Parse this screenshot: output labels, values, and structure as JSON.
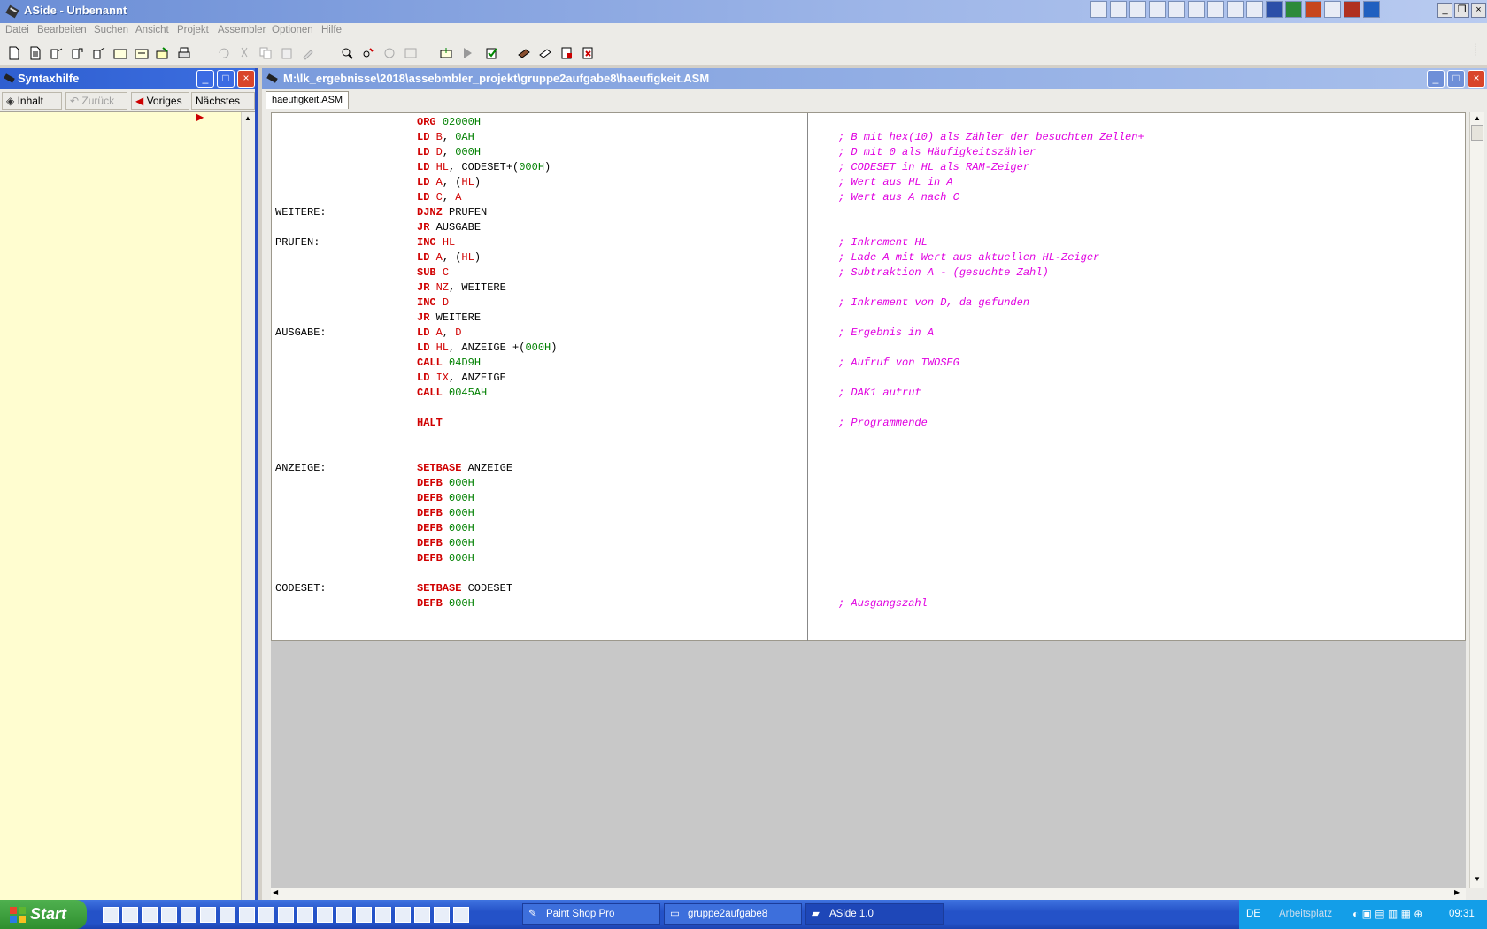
{
  "window": {
    "title": "ASide - Unbenannt"
  },
  "menu": [
    "Datei",
    "Bearbeiten",
    "Suchen",
    "Ansicht",
    "Projekt",
    "Assembler",
    "Optionen",
    "Hilfe"
  ],
  "syntax_panel": {
    "title": "Syntaxhilfe",
    "nav": {
      "contents": "Inhalt",
      "back": "Zurück",
      "previous": "Voriges",
      "next": "Nächstes"
    }
  },
  "editor": {
    "path": "M:\\lk_ergebnisse\\2018\\assebmbler_projekt\\gruppe2aufgabe8\\haeufigkeit.ASM",
    "tab": "haeufigkeit.ASM",
    "lines": [
      {
        "label": "",
        "code": [
          [
            "kw",
            "ORG "
          ],
          [
            "num",
            "02000H"
          ]
        ],
        "comment": ""
      },
      {
        "label": "",
        "code": [
          [
            "kw",
            "LD "
          ],
          [
            "reg",
            "B"
          ],
          [
            "txt",
            ", "
          ],
          [
            "num",
            "0AH"
          ]
        ],
        "comment": "; B mit hex(10) als Zähler der besuchten Zellen+"
      },
      {
        "label": "",
        "code": [
          [
            "kw",
            "LD "
          ],
          [
            "reg",
            "D"
          ],
          [
            "txt",
            ", "
          ],
          [
            "num",
            "000H"
          ]
        ],
        "comment": "; D mit 0 als Häufigkeitszähler"
      },
      {
        "label": "",
        "code": [
          [
            "kw",
            "LD "
          ],
          [
            "reg",
            "HL"
          ],
          [
            "txt",
            ", CODESET+("
          ],
          [
            "num",
            "000H"
          ],
          [
            "txt",
            ")"
          ]
        ],
        "comment": "; CODESET in HL als RAM-Zeiger"
      },
      {
        "label": "",
        "code": [
          [
            "kw",
            "LD "
          ],
          [
            "reg",
            "A"
          ],
          [
            "txt",
            ", ("
          ],
          [
            "reg",
            "HL"
          ],
          [
            "txt",
            ")"
          ]
        ],
        "comment": "; Wert aus HL in A"
      },
      {
        "label": "",
        "code": [
          [
            "kw",
            "LD "
          ],
          [
            "reg",
            "C"
          ],
          [
            "txt",
            ", "
          ],
          [
            "reg",
            "A"
          ]
        ],
        "comment": "; Wert aus A nach C"
      },
      {
        "label": "WEITERE:",
        "code": [
          [
            "kw",
            "DJNZ "
          ],
          [
            "txt",
            "PRUFEN"
          ]
        ],
        "comment": ""
      },
      {
        "label": "",
        "code": [
          [
            "kw",
            "JR "
          ],
          [
            "txt",
            "AUSGABE"
          ]
        ],
        "comment": ""
      },
      {
        "label": "PRUFEN:",
        "code": [
          [
            "kw",
            "INC "
          ],
          [
            "reg",
            "HL"
          ]
        ],
        "comment": "; Inkrement HL"
      },
      {
        "label": "",
        "code": [
          [
            "kw",
            "LD "
          ],
          [
            "reg",
            "A"
          ],
          [
            "txt",
            ", ("
          ],
          [
            "reg",
            "HL"
          ],
          [
            "txt",
            ")"
          ]
        ],
        "comment": "; Lade A mit Wert aus aktuellen HL-Zeiger"
      },
      {
        "label": "",
        "code": [
          [
            "kw",
            "SUB "
          ],
          [
            "reg",
            "C"
          ]
        ],
        "comment": "; Subtraktion A - (gesuchte Zahl)"
      },
      {
        "label": "",
        "code": [
          [
            "kw",
            "JR "
          ],
          [
            "reg",
            "NZ"
          ],
          [
            "txt",
            ", WEITERE"
          ]
        ],
        "comment": ""
      },
      {
        "label": "",
        "code": [
          [
            "kw",
            "INC "
          ],
          [
            "reg",
            "D"
          ]
        ],
        "comment": "; Inkrement von D, da gefunden"
      },
      {
        "label": "",
        "code": [
          [
            "kw",
            "JR "
          ],
          [
            "txt",
            "WEITERE"
          ]
        ],
        "comment": ""
      },
      {
        "label": "AUSGABE:",
        "code": [
          [
            "kw",
            "LD "
          ],
          [
            "reg",
            "A"
          ],
          [
            "txt",
            ", "
          ],
          [
            "reg",
            "D"
          ]
        ],
        "comment": "; Ergebnis in A"
      },
      {
        "label": "",
        "code": [
          [
            "kw",
            "LD "
          ],
          [
            "reg",
            "HL"
          ],
          [
            "txt",
            ", ANZEIGE +("
          ],
          [
            "num",
            "000H"
          ],
          [
            "txt",
            ")"
          ]
        ],
        "comment": ""
      },
      {
        "label": "",
        "code": [
          [
            "kw",
            "CALL "
          ],
          [
            "num",
            "04D9H"
          ]
        ],
        "comment": "; Aufruf von TWOSEG"
      },
      {
        "label": "",
        "code": [
          [
            "kw",
            "LD "
          ],
          [
            "reg",
            "IX"
          ],
          [
            "txt",
            ", ANZEIGE"
          ]
        ],
        "comment": ""
      },
      {
        "label": "",
        "code": [
          [
            "kw",
            "CALL "
          ],
          [
            "num",
            "0045AH"
          ]
        ],
        "comment": "; DAK1 aufruf"
      },
      {
        "label": "",
        "code": [],
        "comment": ""
      },
      {
        "label": "",
        "code": [
          [
            "kw",
            "HALT"
          ]
        ],
        "comment": "; Programmende"
      },
      {
        "label": "",
        "code": [],
        "comment": ""
      },
      {
        "label": "",
        "code": [],
        "comment": ""
      },
      {
        "label": "ANZEIGE:",
        "code": [
          [
            "kw",
            "SETBASE "
          ],
          [
            "txt",
            "ANZEIGE"
          ]
        ],
        "comment": ""
      },
      {
        "label": "",
        "code": [
          [
            "kw",
            "DEFB "
          ],
          [
            "num",
            "000H"
          ]
        ],
        "comment": ""
      },
      {
        "label": "",
        "code": [
          [
            "kw",
            "DEFB "
          ],
          [
            "num",
            "000H"
          ]
        ],
        "comment": ""
      },
      {
        "label": "",
        "code": [
          [
            "kw",
            "DEFB "
          ],
          [
            "num",
            "000H"
          ]
        ],
        "comment": ""
      },
      {
        "label": "",
        "code": [
          [
            "kw",
            "DEFB "
          ],
          [
            "num",
            "000H"
          ]
        ],
        "comment": ""
      },
      {
        "label": "",
        "code": [
          [
            "kw",
            "DEFB "
          ],
          [
            "num",
            "000H"
          ]
        ],
        "comment": ""
      },
      {
        "label": "",
        "code": [
          [
            "kw",
            "DEFB "
          ],
          [
            "num",
            "000H"
          ]
        ],
        "comment": ""
      },
      {
        "label": "",
        "code": [],
        "comment": ""
      },
      {
        "label": "CODESET:",
        "code": [
          [
            "kw",
            "SETBASE "
          ],
          [
            "txt",
            "CODESET"
          ]
        ],
        "comment": ""
      },
      {
        "label": "",
        "code": [
          [
            "kw",
            "DEFB "
          ],
          [
            "num",
            "000H"
          ]
        ],
        "comment": "; Ausgangszahl"
      }
    ]
  },
  "taskbar": {
    "start": "Start",
    "tasks": [
      "Paint Shop Pro",
      "gruppe2aufgabe8",
      "ASide 1.0"
    ],
    "language": "DE",
    "workspace": "Arbeitsplatz",
    "clock": "09:31"
  },
  "colors": {
    "keyword": "#d00000",
    "number": "#008000",
    "comment": "#e000e0",
    "panel_bg": "#fffdd0"
  }
}
